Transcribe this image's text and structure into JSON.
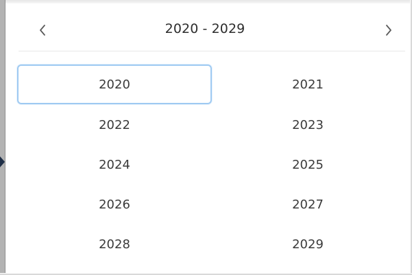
{
  "picker": {
    "range_title": "2020 - 2029",
    "prev_icon": "chevron-left-icon",
    "next_icon": "chevron-right-icon",
    "selected_year": "2020",
    "years": [
      "2020",
      "2021",
      "2022",
      "2023",
      "2024",
      "2025",
      "2026",
      "2027",
      "2028",
      "2029"
    ]
  },
  "colors": {
    "selected_border": "#9fcaf2",
    "text": "#3a3a3a",
    "divider": "#e8e8e8"
  }
}
